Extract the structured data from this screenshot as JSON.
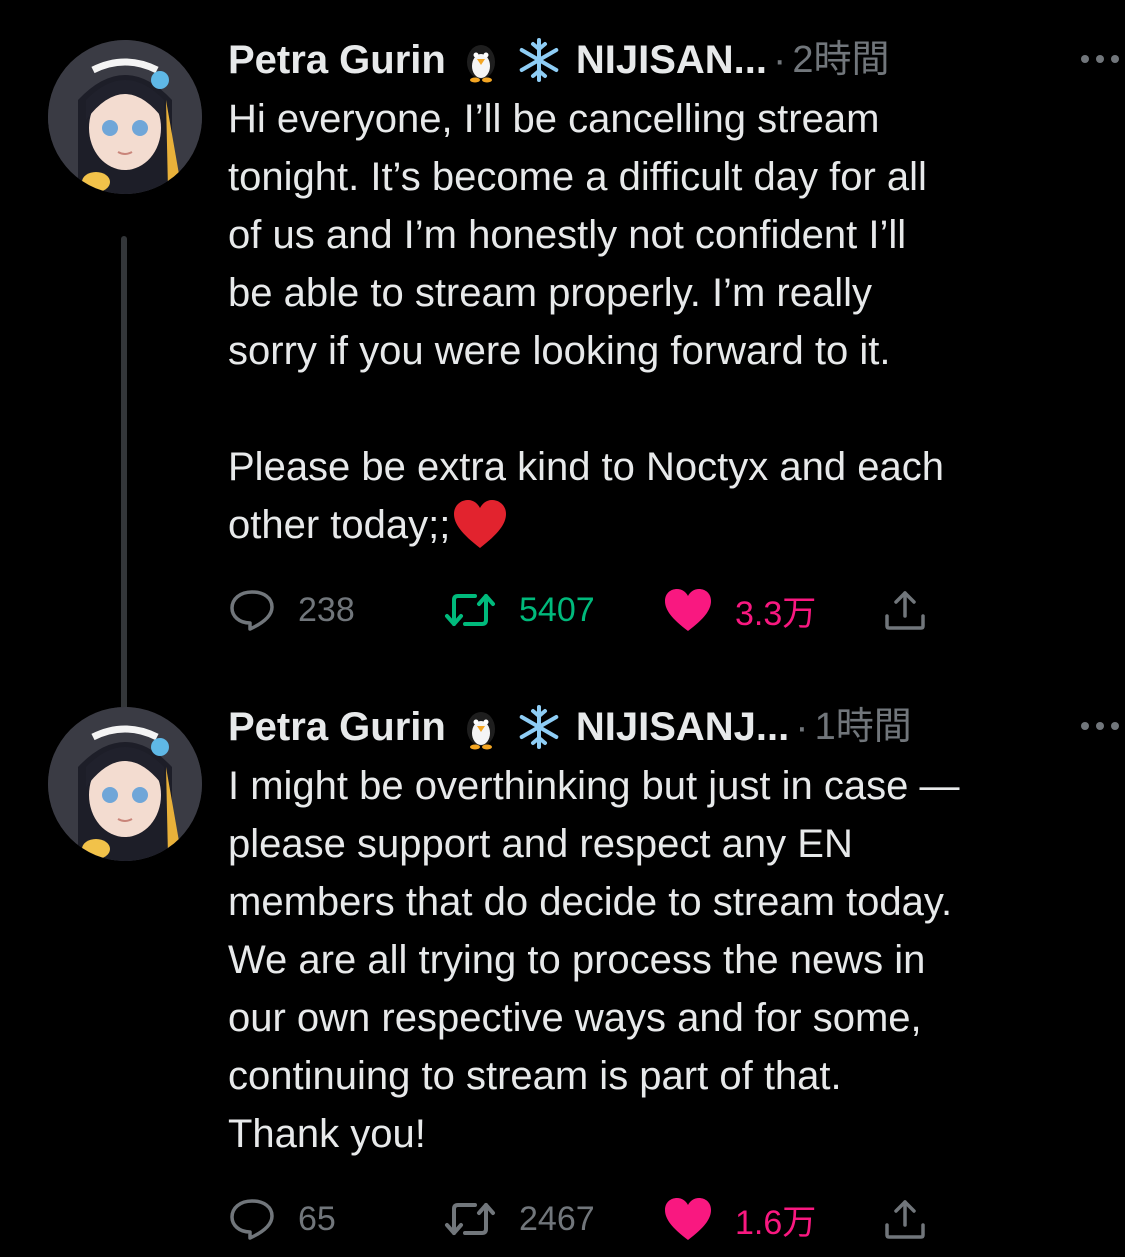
{
  "colors": {
    "background": "#000000",
    "text": "#e7e9ea",
    "secondary": "#71767b",
    "retweet_active": "#00ba7c",
    "like_active": "#f91880"
  },
  "tweets": [
    {
      "author_name": "Petra Gurin",
      "emojis": [
        "penguin-emoji",
        "snowflake-emoji"
      ],
      "org_name": "NIJISAN...",
      "separator": "·",
      "time": "2時間",
      "text": "Hi everyone, I’ll be cancelling stream\ntonight. It’s become a difficult day for all\nof us and I’m honestly not confident I’ll\nbe able to stream properly. I’m really\nsorry if you were looking forward to it.\n\nPlease be extra kind to Noctyx and each\nother today;;",
      "trailing_emoji": "red-heart-emoji",
      "replies": "238",
      "retweets": "5407",
      "likes": "3.3万",
      "liked": true,
      "retweeted": true
    },
    {
      "author_name": "Petra Gurin",
      "emojis": [
        "penguin-emoji",
        "snowflake-emoji"
      ],
      "org_name": "NIJISANJ...",
      "separator": "·",
      "time": "1時間",
      "text": "I might be overthinking but just in case —\nplease support and respect any EN\nmembers that do decide to stream today.\nWe are all trying to process the news in\nour own respective ways and for some,\ncontinuing to stream is part of that.\nThank you!",
      "replies": "65",
      "retweets": "2467",
      "likes": "1.6万",
      "liked": true,
      "retweeted": false
    }
  ]
}
